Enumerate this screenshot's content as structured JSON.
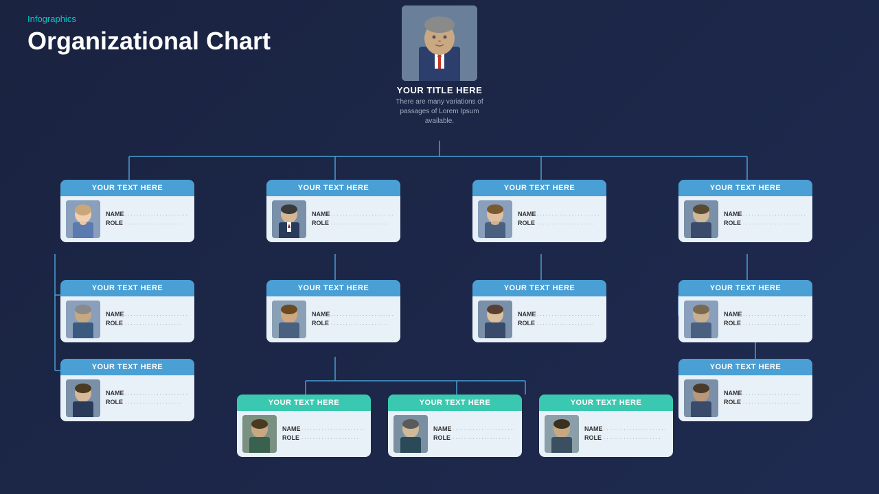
{
  "page": {
    "infographics_label": "Infographics",
    "main_title": "Organizational Chart",
    "top_person": {
      "title": "YOUR TITLE HERE",
      "subtitle": "There are many variations of passages of Lorem Ipsum available."
    },
    "accent_blue": "#4a9fd4",
    "accent_teal": "#3ac9b0"
  },
  "cards": {
    "level1": [
      {
        "id": "c1",
        "header": "YOUR TEXT HERE",
        "header_class": "blue",
        "name_dots": "......................",
        "role_dots": "...................."
      },
      {
        "id": "c2",
        "header": "YOUR TEXT HERE",
        "header_class": "blue",
        "name_dots": "......................",
        "role_dots": "...................."
      },
      {
        "id": "c3",
        "header": "YOUR TEXT HERE",
        "header_class": "blue",
        "name_dots": "......................",
        "role_dots": "...................."
      },
      {
        "id": "c4",
        "header": "YOUR TEXT HERE",
        "header_class": "blue",
        "name_dots": "......................",
        "role_dots": "...................."
      }
    ],
    "level2_left": [
      {
        "id": "c5",
        "header": "YOUR TEXT HERE",
        "header_class": "blue",
        "name_dots": "......................",
        "role_dots": "...................."
      },
      {
        "id": "c6",
        "header": "YOUR TEXT HERE",
        "header_class": "blue",
        "name_dots": "......................",
        "role_dots": "...................."
      }
    ],
    "level2_mid": [
      {
        "id": "c7",
        "header": "YOUR TEXT HERE",
        "header_class": "blue",
        "name_dots": "......................",
        "role_dots": "...................."
      }
    ],
    "level2_right_mid": [
      {
        "id": "c8",
        "header": "YOUR TEXT HERE",
        "header_class": "blue",
        "name_dots": "......................",
        "role_dots": "...................."
      }
    ],
    "level2_far_right": [
      {
        "id": "c9",
        "header": "YOUR TEXT HERE",
        "header_class": "blue",
        "name_dots": "......................",
        "role_dots": "...................."
      }
    ],
    "level3_bottom": [
      {
        "id": "c10",
        "header": "YOUR TEXT HERE",
        "header_class": "teal",
        "name_dots": "......................",
        "role_dots": "...................."
      },
      {
        "id": "c11",
        "header": "YOUR TEXT HERE",
        "header_class": "teal",
        "name_dots": "......................",
        "role_dots": "...................."
      },
      {
        "id": "c12",
        "header": "YOUR TEXT HERE",
        "header_class": "teal",
        "name_dots": "......................",
        "role_dots": "...................."
      }
    ],
    "labels": {
      "name": "NAME",
      "role": "ROLE"
    }
  }
}
